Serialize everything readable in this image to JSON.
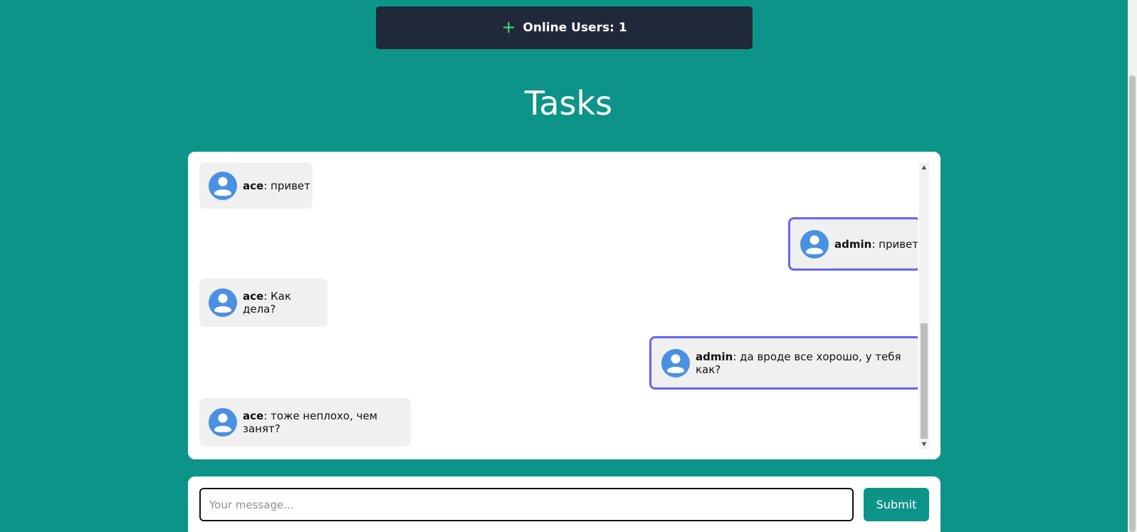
{
  "header": {
    "online_users_label": "Online Users: 1",
    "plus_glyph": "+"
  },
  "page": {
    "title": "Tasks"
  },
  "chat": {
    "messages": [
      {
        "user": "ace",
        "text": ": привет",
        "own": false
      },
      {
        "user": "admin",
        "text": ": привет",
        "own": true
      },
      {
        "user": "ace",
        "text": ": Как дела?",
        "own": false
      },
      {
        "user": "admin",
        "text": ": да вроде все хорошо, у тебя как?",
        "own": true
      },
      {
        "user": "ace",
        "text": ": тоже неплохо, чем занят?",
        "own": false
      }
    ]
  },
  "composer": {
    "placeholder": "Your message...",
    "value": "",
    "submit_label": "Submit"
  },
  "colors": {
    "background": "#0d9488",
    "header_bar": "#1f2937",
    "plus_icon": "#4ade80",
    "own_message_border": "#6366f1",
    "avatar": "#4a90e2",
    "message_bubble": "#f0f0f0"
  },
  "icons": {
    "plus": "plus-icon",
    "avatar": "user-avatar-icon"
  }
}
